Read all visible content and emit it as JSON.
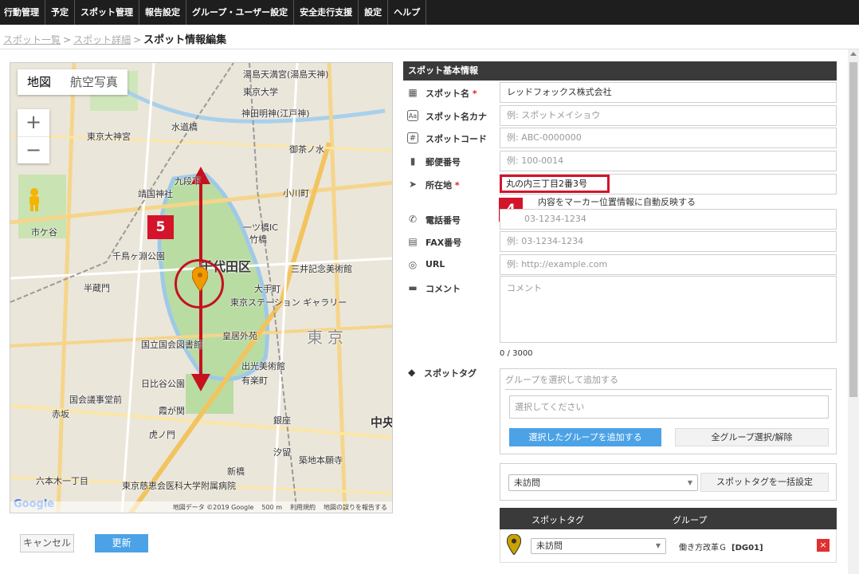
{
  "nav": [
    "行動管理",
    "予定",
    "スポット管理",
    "報告設定",
    "グループ・ユーザー設定",
    "安全走行支援",
    "設定",
    "ヘルプ"
  ],
  "breadcrumb": {
    "link1": "スポット一覧",
    "link2": "スポット詳細",
    "sep": ">",
    "current": "スポット情報編集"
  },
  "map": {
    "type_map": "地図",
    "type_aerial": "航空写真",
    "zoom_in": "+",
    "zoom_out": "−",
    "step_label": "5",
    "district": "千代田区",
    "city": "東京",
    "labels": {
      "l1": "湯島天満宮(湯島天神)",
      "l2": "東京大学",
      "l3": "神田明神(江戸神)",
      "l4": "水道橋",
      "l5": "東京大神宮",
      "l6": "靖国神社",
      "l7": "九段下",
      "l8": "一ツ橋IC",
      "l9": "竹橋",
      "l10": "千鳥ヶ淵公園",
      "l11": "大手町",
      "l12": "東京ステーション ギャラリー",
      "l13": "皇居外苑",
      "l14": "半蔵門",
      "l15": "国立国会図書館",
      "l16": "日比谷公園",
      "l17": "国会議事堂前",
      "l18": "虎ノ門",
      "l19": "東京慈恵会医科大学附属病院",
      "l20": "三井記念美術館",
      "l21": "有楽町",
      "l22": "新橋",
      "l23": "赤坂",
      "l24": "市ケ谷",
      "l25": "小川町",
      "l26": "御茶ノ水",
      "l27": "出光美術館",
      "l28": "銀座",
      "l29": "霞が関",
      "l30": "六本木一丁目",
      "l31": "築地本願寺",
      "l32": "汐留",
      "l33": "中央"
    },
    "footer": {
      "copyright": "地図データ ©2019 Google",
      "scale": "500 m",
      "terms": "利用規約",
      "report": "地図の誤りを報告する"
    },
    "logo": "Google"
  },
  "buttons": {
    "cancel": "キャンセル",
    "update": "更新"
  },
  "form": {
    "header": "スポット基本情報",
    "fields": {
      "name": {
        "label": "スポット名",
        "req": "*",
        "value": "レッドフォックス株式会社"
      },
      "kana": {
        "label": "スポット名カナ",
        "placeholder": "例: スポットメイショウ"
      },
      "code": {
        "label": "スポットコード",
        "placeholder": "例: ABC-0000000"
      },
      "zip": {
        "label": "郵便番号",
        "placeholder": "例: 100-0014"
      },
      "address": {
        "label": "所在地",
        "req": "*",
        "value": "丸の内三丁目2番3号",
        "note": "内容をマーカー位置情報に自動反映する"
      },
      "tel": {
        "label": "電話番号",
        "placeholder": "03-1234-1234"
      },
      "fax": {
        "label": "FAX番号",
        "placeholder": "例: 03-1234-1234"
      },
      "url": {
        "label": "URL",
        "placeholder": "例: http://example.com"
      },
      "comment": {
        "label": "コメント",
        "placeholder": "コメント",
        "counter": "0 / 3000"
      }
    },
    "step_label": "4",
    "tags": {
      "label": "スポットタグ",
      "group_placeholder": "グループを選択して追加する",
      "select_placeholder": "選択してください",
      "add_button": "選択したグループを追加する",
      "toggle_button": "全グループ選択/解除",
      "bulk_value": "未訪問",
      "bulk_button": "スポットタグを一括設定",
      "table": {
        "col_tag": "スポットタグ",
        "col_group": "グループ",
        "row": {
          "tag": "未訪問",
          "group": "働き方改革Ｇ",
          "code": "[DG01]",
          "delete": "×"
        }
      }
    }
  }
}
